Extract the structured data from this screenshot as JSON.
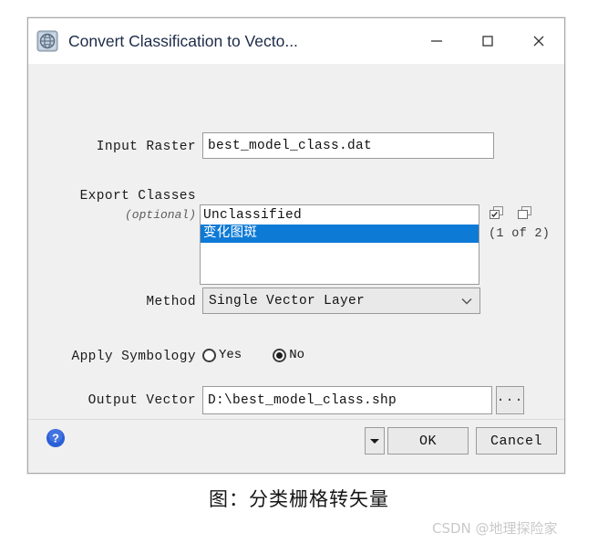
{
  "window": {
    "title": "Convert Classification to Vecto...",
    "icon": "envi-globe-icon",
    "minimize_label": "–",
    "maximize_label": "□",
    "close_label": "✕"
  },
  "form": {
    "input_raster": {
      "label": "Input Raster",
      "value": "best_model_class.dat"
    },
    "export_classes": {
      "label": "Export Classes",
      "sublabel": "(optional)",
      "items": [
        {
          "text": "Unclassified",
          "selected": false
        },
        {
          "text": "变化图斑",
          "selected": true
        }
      ],
      "count_text": "(1 of 2)",
      "select_all_icon": "select-all-icon",
      "clear_selection_icon": "clear-selection-icon"
    },
    "method": {
      "label": "Method",
      "value": "Single Vector Layer",
      "arrow_icon": "chevron-down-icon"
    },
    "apply_symbology": {
      "label": "Apply Symbology",
      "options": [
        {
          "text": "Yes",
          "selected": false
        },
        {
          "text": "No",
          "selected": true
        }
      ]
    },
    "output_vector": {
      "label": "Output Vector",
      "value": "D:\\best_model_class.shp",
      "browse_label": "..."
    }
  },
  "footer": {
    "help_icon": "help-question-icon",
    "dropdown_icon": "triangle-down-icon",
    "ok_label": "OK",
    "cancel_label": "Cancel"
  },
  "page": {
    "caption": "图：分类栅格转矢量",
    "watermark": "CSDN @地理探险家"
  },
  "colors": {
    "selection_blue": "#0d7ad6",
    "dialog_bg": "#f0f0f0",
    "title_text": "#1d2b48",
    "help_blue": "#2a5fd6"
  }
}
